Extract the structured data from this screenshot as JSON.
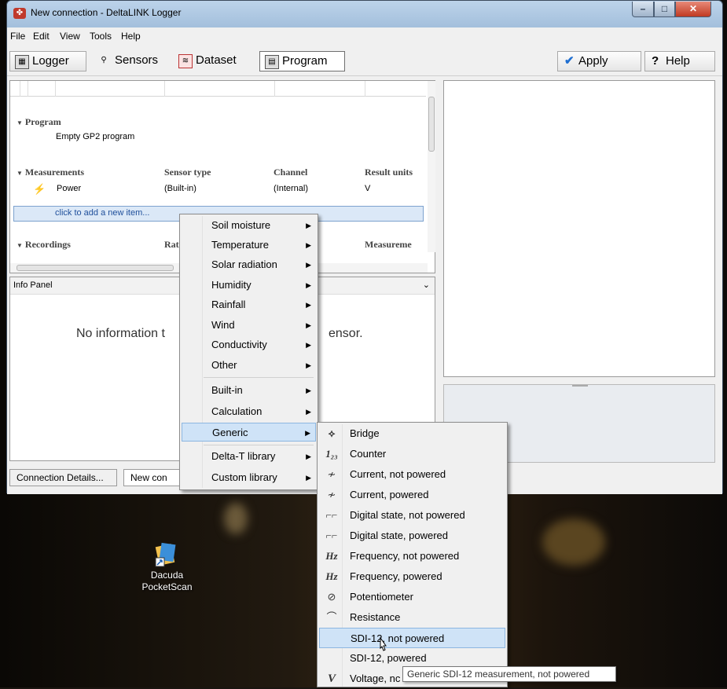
{
  "window": {
    "title": "New connection - DeltaLINK Logger"
  },
  "menu": [
    "File",
    "Edit",
    "View",
    "Tools",
    "Help"
  ],
  "toolbar": {
    "logger": "Logger",
    "sensors": "Sensors",
    "dataset": "Dataset",
    "program": "Program",
    "apply": "Apply",
    "help": "Help"
  },
  "program": {
    "group_label": "Program",
    "name": "Empty GP2 program",
    "measurements_label": "Measurements",
    "col_sensor_type": "Sensor type",
    "col_channel": "Channel",
    "col_result_units": "Result units",
    "row": {
      "name": "Power",
      "sensor_type": "(Built-in)",
      "channel": "(Internal)",
      "units": "V"
    },
    "add_item": "click to add a new item...",
    "recordings_label": "Recordings",
    "rat_partial": "Rat",
    "measurements_partial": "Measureme"
  },
  "info_panel": {
    "title": "Info Panel",
    "message_left": "No information t",
    "message_right": "ensor."
  },
  "bottom_tabs": [
    "Connection Details...",
    "New con"
  ],
  "context_menu": [
    {
      "label": "Soil moisture",
      "submenu": true
    },
    {
      "label": "Temperature",
      "submenu": true
    },
    {
      "label": "Solar radiation",
      "submenu": true
    },
    {
      "label": "Humidity",
      "submenu": true
    },
    {
      "label": "Rainfall",
      "submenu": true
    },
    {
      "label": "Wind",
      "submenu": true
    },
    {
      "label": "Conductivity",
      "submenu": true
    },
    {
      "label": "Other",
      "submenu": true
    },
    {
      "label": "Built-in",
      "submenu": true
    },
    {
      "label": "Calculation",
      "submenu": true
    },
    {
      "label": "Generic",
      "submenu": true,
      "highlighted": true
    },
    {
      "label": "Delta-T library",
      "submenu": true
    },
    {
      "label": "Custom library",
      "submenu": true
    }
  ],
  "submenu": [
    {
      "label": "Bridge",
      "icon": "bridge-icon",
      "glyph": "⟡"
    },
    {
      "label": "Counter",
      "icon": "counter-icon",
      "glyph": "1₂₃"
    },
    {
      "label": "Current, not powered",
      "icon": "current-icon",
      "glyph": "⟋"
    },
    {
      "label": "Current, powered",
      "icon": "current-icon",
      "glyph": "⟋"
    },
    {
      "label": "Digital state, not powered",
      "icon": "digital-state-icon",
      "glyph": "⎍"
    },
    {
      "label": "Digital state, powered",
      "icon": "digital-state-icon",
      "glyph": "⎍"
    },
    {
      "label": "Frequency, not powered",
      "icon": "frequency-icon",
      "glyph": "Hz"
    },
    {
      "label": "Frequency, powered",
      "icon": "frequency-icon",
      "glyph": "Hz"
    },
    {
      "label": "Potentiometer",
      "icon": "potentiometer-icon",
      "glyph": "⊘"
    },
    {
      "label": "Resistance",
      "icon": "resistance-icon",
      "glyph": "⌒"
    },
    {
      "label": "SDI-12, not powered",
      "icon": "",
      "glyph": "",
      "highlighted": true
    },
    {
      "label": "SDI-12, powered",
      "icon": "",
      "glyph": ""
    },
    {
      "label": "Voltage, nc",
      "icon": "voltage-icon",
      "glyph": "V"
    }
  ],
  "tooltip": "Generic SDI-12 measurement, not powered",
  "desktop_icon": {
    "label_line1": "Dacuda",
    "label_line2": "PocketScan"
  }
}
